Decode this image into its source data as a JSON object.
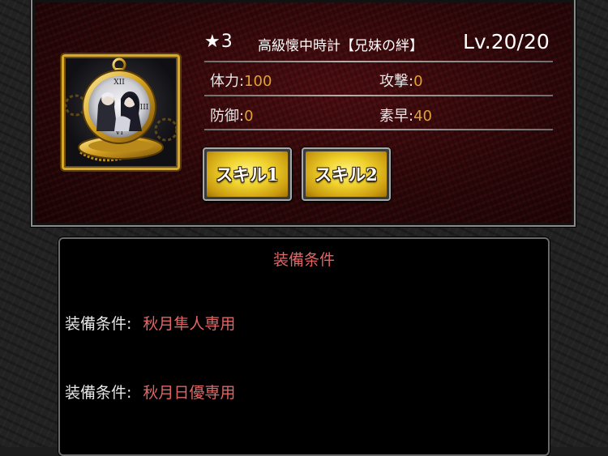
{
  "item": {
    "rarity": "★3",
    "name": "高級懐中時計【兄妹の絆】",
    "level": "Lv.20/20",
    "icon": "pocket-watch-icon"
  },
  "stats": {
    "hp_label": "体力:",
    "hp_value": "100",
    "attack_label": "攻撃:",
    "attack_value": "0",
    "defense_label": "防御:",
    "defense_value": "0",
    "speed_label": "素早:",
    "speed_value": "40"
  },
  "buttons": {
    "skill1": "スキル1",
    "skill2": "スキル2"
  },
  "conditions": {
    "title": "装備条件",
    "rows": [
      {
        "label": "装備条件:",
        "value": "秋月隼人専用"
      },
      {
        "label": "装備条件:",
        "value": "秋月日優専用"
      }
    ]
  },
  "colors": {
    "accent_gold": "#e0a233",
    "condition_red": "#e06565",
    "panel_red": "#4a0d10"
  }
}
